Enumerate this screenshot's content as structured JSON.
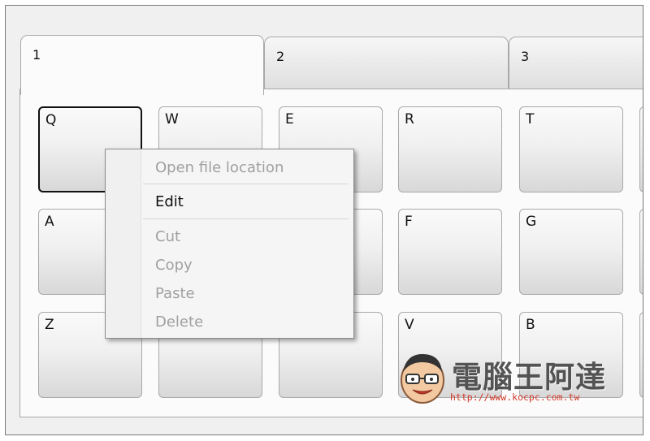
{
  "tabs": [
    {
      "label": "1",
      "active": true
    },
    {
      "label": "2",
      "active": false
    },
    {
      "label": "3",
      "active": false
    }
  ],
  "keys": {
    "row1": [
      "Q",
      "W",
      "E",
      "R",
      "T"
    ],
    "row2": [
      "A",
      "",
      "",
      "F",
      "G"
    ],
    "row3": [
      "Z",
      "",
      "",
      "V",
      "B"
    ]
  },
  "selected_key": "Q",
  "context_menu": {
    "open_file_location": "Open file location",
    "edit": "Edit",
    "cut": "Cut",
    "copy": "Copy",
    "paste": "Paste",
    "delete": "Delete"
  },
  "watermark": {
    "title": "電腦王阿達",
    "url": "http://www.kocpc.com.tw"
  }
}
